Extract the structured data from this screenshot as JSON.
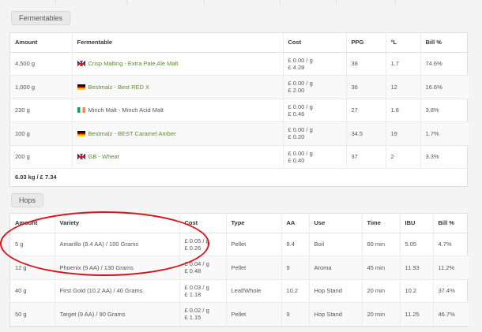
{
  "fermentables": {
    "section_label": "Fermentables",
    "columns": [
      "Amount",
      "Fermentable",
      "Cost",
      "PPG",
      "°L",
      "Bill %"
    ],
    "rows": [
      {
        "amount": "4,500 g",
        "flag": "gb-flag-icon",
        "name": "Crisp Malting - Extra Pale Ale Malt",
        "linked": true,
        "cost_unit": "£ 0.00 / g",
        "cost_total": "£ 4.28",
        "ppg": "38",
        "lovibond": "1.7",
        "bill": "74.6%"
      },
      {
        "amount": "1,000 g",
        "flag": "de-flag-icon",
        "name": "Bestmalz - Best RED X",
        "linked": true,
        "cost_unit": "£ 0.00 / g",
        "cost_total": "£ 2.00",
        "ppg": "36",
        "lovibond": "12",
        "bill": "16.6%"
      },
      {
        "amount": "230 g",
        "flag": "ie-flag-icon",
        "name": "Minch Malt - Minch Acid Malt",
        "linked": false,
        "cost_unit": "£ 0.00 / g",
        "cost_total": "£ 0.46",
        "ppg": "27",
        "lovibond": "1.8",
        "bill": "3.8%"
      },
      {
        "amount": "100 g",
        "flag": "de-flag-icon",
        "name": "Bestmalz - BEST Caramel Amber",
        "linked": true,
        "cost_unit": "£ 0.00 / g",
        "cost_total": "£ 0.20",
        "ppg": "34.5",
        "lovibond": "19",
        "bill": "1.7%"
      },
      {
        "amount": "200 g",
        "flag": "gb-flag-icon",
        "name": "GB - Wheat",
        "linked": true,
        "cost_unit": "£ 0.00 / g",
        "cost_total": "£ 0.40",
        "ppg": "37",
        "lovibond": "2",
        "bill": "3.3%"
      }
    ],
    "total": "6.03 kg / £ 7.34"
  },
  "hops": {
    "section_label": "Hops",
    "columns": [
      "Amount",
      "Variety",
      "Cost",
      "Type",
      "AA",
      "Use",
      "Time",
      "IBU",
      "Bill %"
    ],
    "rows": [
      {
        "amount": "5 g",
        "variety": "Amarillo (8.4 AA) / 100 Grams",
        "cost_unit": "£ 0.05 / g",
        "cost_total": "£ 0.26",
        "type": "Pellet",
        "aa": "8.4",
        "use": "Boil",
        "time": "60 min",
        "ibu": "5.05",
        "bill": "4.7%"
      },
      {
        "amount": "12 g",
        "variety": "Phoenix (9 AA) / 130 Grams",
        "cost_unit": "£ 0.04 / g",
        "cost_total": "£ 0.48",
        "type": "Pellet",
        "aa": "9",
        "use": "Aroma",
        "time": "45 min",
        "ibu": "11.93",
        "bill": "11.2%"
      },
      {
        "amount": "40 g",
        "variety": "First Gold (10.2 AA) / 40 Grams",
        "cost_unit": "£ 0.03 / g",
        "cost_total": "£ 1.18",
        "type": "Leaf/Whole",
        "aa": "10.2",
        "use": "Hop Stand",
        "time": "20 min",
        "ibu": "10.2",
        "bill": "37.4%"
      },
      {
        "amount": "50 g",
        "variety": "Target (9 AA) / 90 Grams",
        "cost_unit": "£ 0.02 / g",
        "cost_total": "£ 1.15",
        "type": "Pellet",
        "aa": "9",
        "use": "Hop Stand",
        "time": "20 min",
        "ibu": "11.25",
        "bill": "46.7%"
      }
    ]
  },
  "colors": {
    "annotation": "#d8141b",
    "link": "#5c8a2e"
  }
}
